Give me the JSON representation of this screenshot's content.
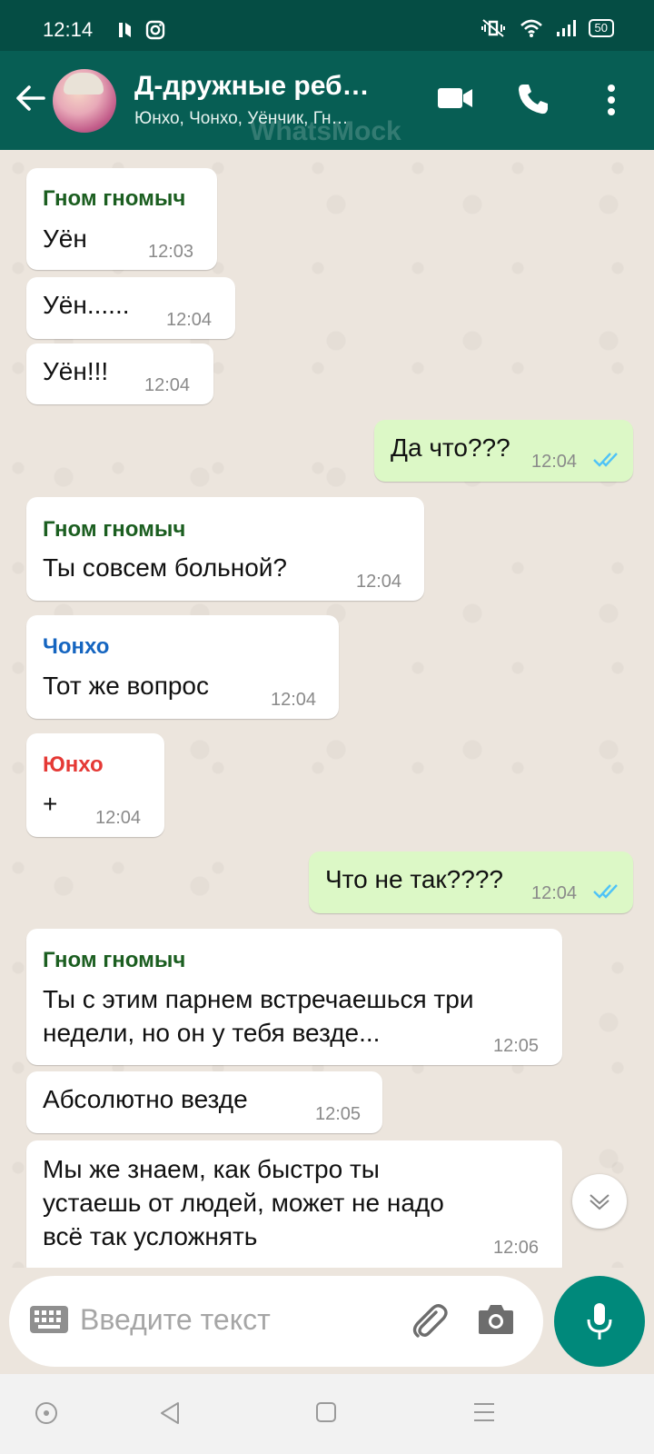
{
  "status_bar": {
    "time": "12:14",
    "battery": "50"
  },
  "header": {
    "title": "Д-дружные реб…",
    "subtitle": "Юнхо, Чонхо, Уёнчик, Гн…",
    "watermark": "WhatsMock"
  },
  "messages": [
    {
      "sender": "Гном гномыч",
      "sender_color": "#1b5e20",
      "text": "Уён",
      "time": "12:03"
    },
    {
      "text": "Уён......",
      "time": "12:04"
    },
    {
      "text": "Уён!!!",
      "time": "12:04"
    },
    {
      "outgoing": true,
      "text": "Да что???",
      "time": "12:04",
      "read": true
    },
    {
      "sender": "Гном гномыч",
      "sender_color": "#1b5e20",
      "text": "Ты совсем больной?",
      "time": "12:04"
    },
    {
      "sender": "Чонхо",
      "sender_color": "#1565c0",
      "text": "Тот же вопрос",
      "time": "12:04"
    },
    {
      "sender": "Юнхо",
      "sender_color": "#e53935",
      "text": "+",
      "time": "12:04"
    },
    {
      "outgoing": true,
      "text": "Что не так????",
      "time": "12:04",
      "read": true
    },
    {
      "sender": "Гном гномыч",
      "sender_color": "#1b5e20",
      "text": "Ты с этим парнем встречаешься три\nнедели, но он у тебя везде...",
      "time": "12:05"
    },
    {
      "text": "Абсолютно везде",
      "time": "12:05"
    },
    {
      "text": "Мы же знаем, как быстро ты\nустаешь от людей, может не надо\nвсё так усложнять",
      "time": "12:06"
    }
  ],
  "input": {
    "placeholder": "Введите текст"
  },
  "colors": {
    "header": "#075e54",
    "status_bar": "#054d44",
    "outgoing_bubble": "#dcf8c6",
    "read_ticks": "#4fc3f7",
    "mic_button": "#00897b"
  },
  "icons": [
    "back-arrow-icon",
    "video-call-icon",
    "phone-icon",
    "more-vert-icon",
    "keyboard-icon",
    "attach-icon",
    "camera-icon",
    "mic-icon",
    "chevron-down-icon"
  ]
}
